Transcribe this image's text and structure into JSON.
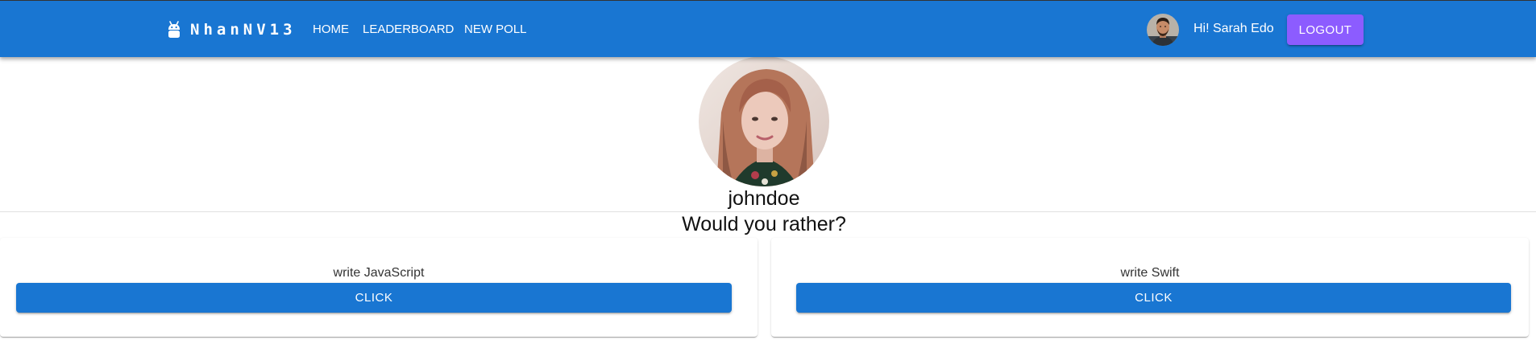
{
  "header": {
    "brand": "NhanNV13",
    "nav": [
      {
        "label": "HOME"
      },
      {
        "label": "LEADERBOARD"
      },
      {
        "label": "NEW POLL"
      }
    ],
    "greeting": "Hi! Sarah Edo",
    "logout_label": "LOGOUT",
    "logo_icon": "android-icon",
    "user_avatar": "avatar-man-photo"
  },
  "poll": {
    "author": "johndoe",
    "author_avatar": "avatar-woman-photo",
    "question": "Would you rather?",
    "options": [
      {
        "text": "write JavaScript",
        "button_label": "CLICK"
      },
      {
        "text": "write Swift",
        "button_label": "CLICK"
      }
    ]
  },
  "colors": {
    "appbar": "#1976d2",
    "logout_button": "#8c5cff",
    "option_button": "#1976d2",
    "text": "#111111"
  }
}
